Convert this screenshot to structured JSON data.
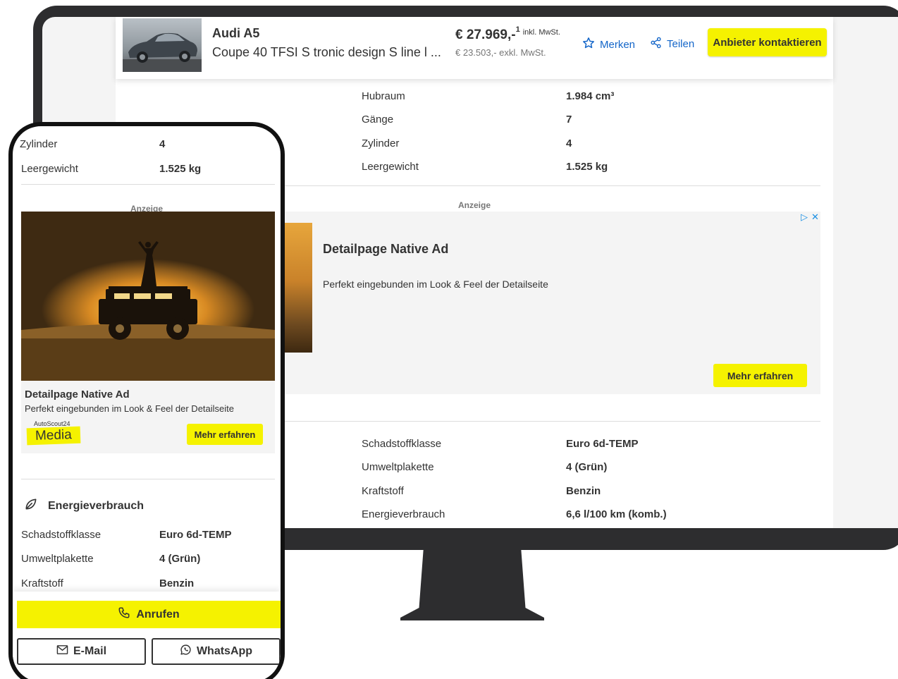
{
  "desktop": {
    "listing": {
      "title": "Audi A5",
      "subtitle": "Coupe 40 TFSI S tronic design S line l ...",
      "price": "€ 27.969,-",
      "price_footnote": "1",
      "price_tax_note": "inkl. MwSt.",
      "price_net": "€ 23.503,- exkl. MwSt.",
      "save_label": "Merken",
      "share_label": "Teilen",
      "contact_label": "Anbieter kontaktieren"
    },
    "specs_top": [
      {
        "label": "Hubraum",
        "value": "1.984 cm³"
      },
      {
        "label": "Gänge",
        "value": "7"
      },
      {
        "label": "Zylinder",
        "value": "4"
      },
      {
        "label": "Leergewicht",
        "value": "1.525 kg"
      }
    ],
    "ad": {
      "label": "Anzeige",
      "title": "Detailpage Native Ad",
      "text": "Perfekt eingebunden im Look & Feel der Detailseite",
      "cta": "Mehr erfahren"
    },
    "specs_bottom": [
      {
        "label": "Schadstoffklasse",
        "value": "Euro 6d-TEMP"
      },
      {
        "label": "Umweltplakette",
        "value": "4 (Grün)"
      },
      {
        "label": "Kraftstoff",
        "value": "Benzin"
      },
      {
        "label": "Energieverbrauch",
        "value": "6,6 l/100 km (komb.)"
      }
    ]
  },
  "mobile": {
    "specs_top": [
      {
        "label": "Zylinder",
        "value": "4"
      },
      {
        "label": "Leergewicht",
        "value": "1.525 kg"
      }
    ],
    "ad": {
      "label": "Anzeige",
      "title": "Detailpage Native Ad",
      "text": "Perfekt eingebunden im Look & Feel der Detailseite",
      "brand_small": "AutoScout24",
      "brand_media": "Media",
      "cta": "Mehr erfahren"
    },
    "section_title": "Energieverbrauch",
    "specs_bottom": [
      {
        "label": "Schadstoffklasse",
        "value": "Euro 6d-TEMP"
      },
      {
        "label": "Umweltplakette",
        "value": "4 (Grün)"
      },
      {
        "label": "Kraftstoff",
        "value": "Benzin"
      }
    ],
    "call_label": "Anrufen",
    "email_label": "E-Mail",
    "whatsapp_label": "WhatsApp"
  },
  "colors": {
    "accent_yellow": "#f5f200",
    "link_blue": "#1466c9",
    "text": "#333333",
    "device_frame": "#2d2d2f"
  }
}
